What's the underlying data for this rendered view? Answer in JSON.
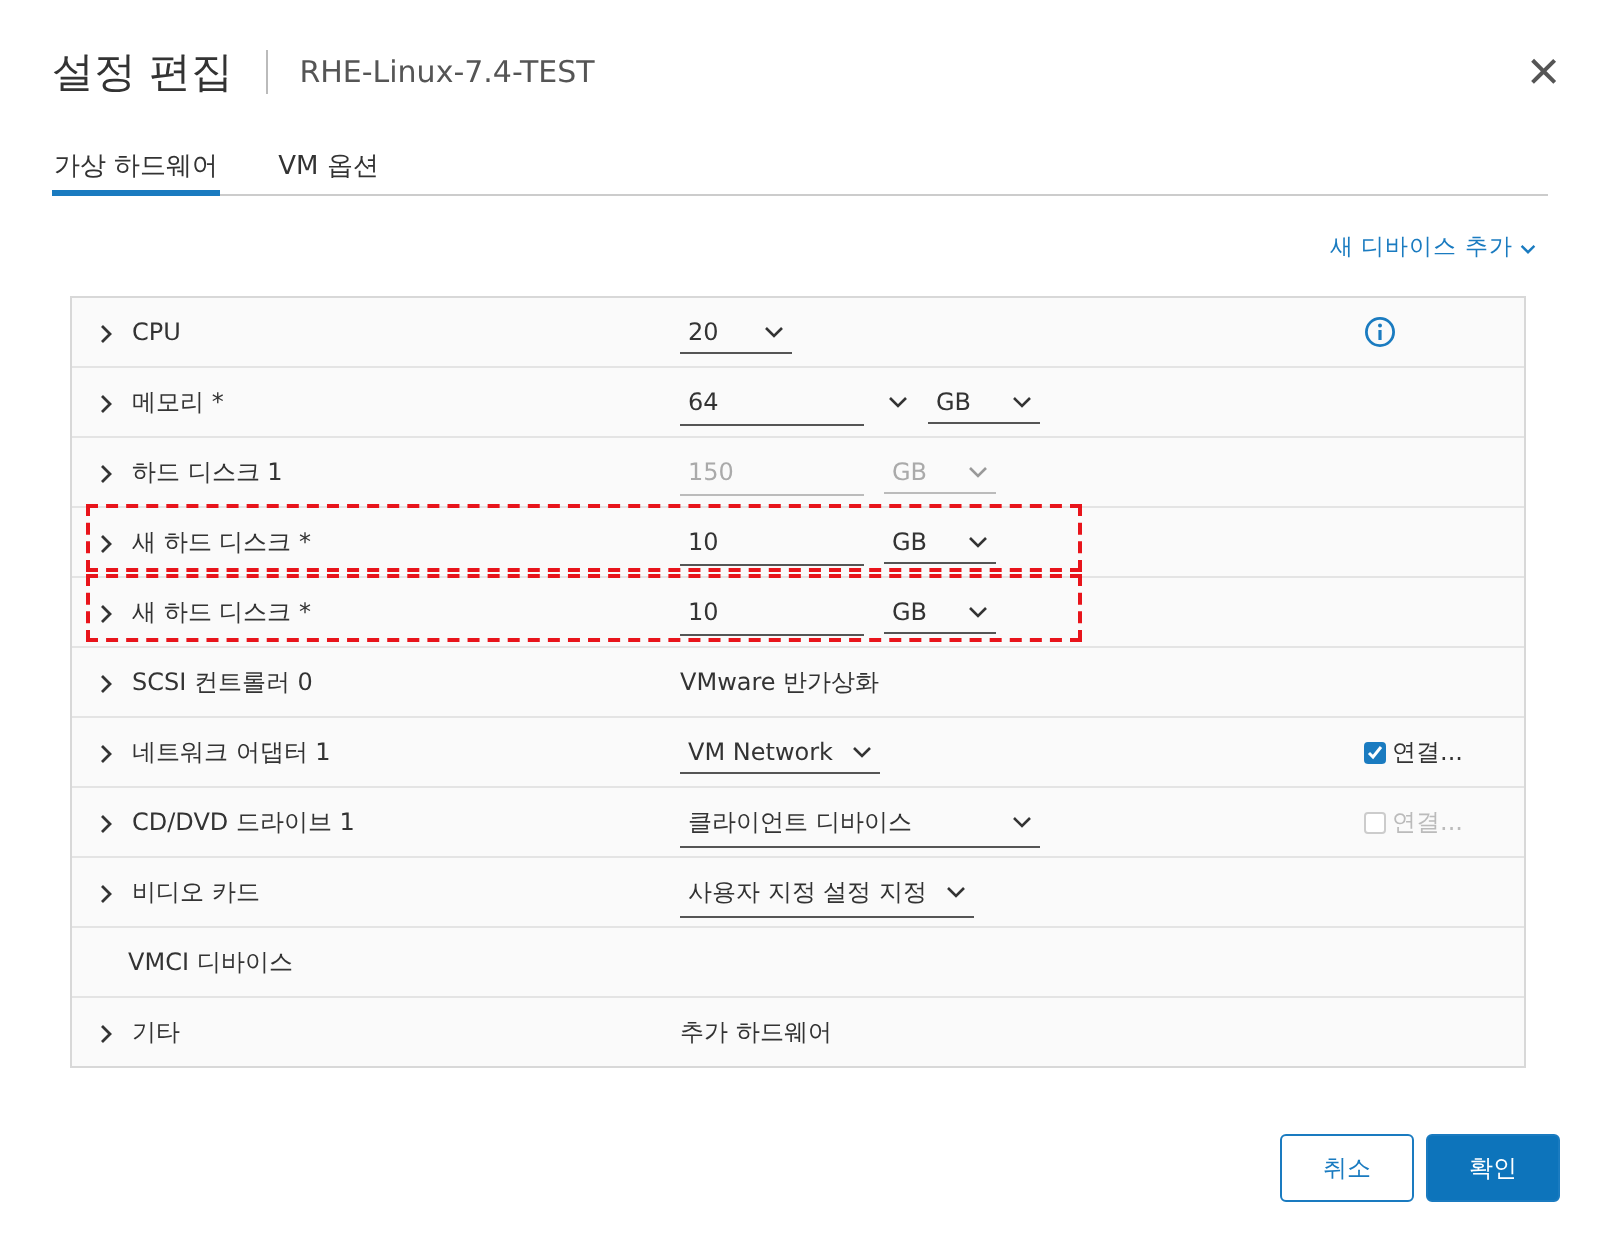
{
  "dialog": {
    "title": "설정 편집",
    "subtitle": "RHE-Linux-7.4-TEST",
    "close": "×"
  },
  "tabs": [
    {
      "label": "가상 하드웨어",
      "selected": true
    },
    {
      "label": "VM 옵션",
      "selected": false
    }
  ],
  "add_device": "새 디바이스 추가",
  "rows": [
    {
      "label": "CPU",
      "expandable": true,
      "highlighted": false,
      "info": true,
      "controls": [
        {
          "kind": "select",
          "value": "20",
          "disabled": false
        }
      ]
    },
    {
      "label": "메모리 *",
      "expandable": true,
      "highlighted": false,
      "controls": [
        {
          "kind": "combo",
          "value": "64",
          "disabled": false
        },
        {
          "kind": "select",
          "value": "GB",
          "disabled": false
        }
      ]
    },
    {
      "label": "하드 디스크 1",
      "expandable": true,
      "highlighted": false,
      "controls": [
        {
          "kind": "input",
          "value": "150",
          "disabled": true
        },
        {
          "kind": "select",
          "value": "GB",
          "disabled": true
        }
      ]
    },
    {
      "label": "새 하드 디스크 *",
      "expandable": true,
      "highlighted": true,
      "controls": [
        {
          "kind": "input",
          "value": "10",
          "disabled": false
        },
        {
          "kind": "select",
          "value": "GB",
          "disabled": false
        }
      ]
    },
    {
      "label": "새 하드 디스크 *",
      "expandable": true,
      "highlighted": true,
      "controls": [
        {
          "kind": "input",
          "value": "10",
          "disabled": false
        },
        {
          "kind": "select",
          "value": "GB",
          "disabled": false
        }
      ]
    },
    {
      "label": "SCSI 컨트롤러 0",
      "expandable": true,
      "highlighted": false,
      "controls": [
        {
          "kind": "text",
          "value": "VMware 반가상화"
        }
      ]
    },
    {
      "label": "네트워크 어댑터 1",
      "expandable": true,
      "highlighted": false,
      "controls": [
        {
          "kind": "select",
          "value": "VM Network",
          "disabled": false
        }
      ],
      "connect": {
        "label": "연결...",
        "checked": true,
        "disabled": false
      }
    },
    {
      "label": "CD/DVD 드라이브 1",
      "expandable": true,
      "highlighted": false,
      "controls": [
        {
          "kind": "wide-select",
          "value": "클라이언트 디바이스",
          "disabled": false
        }
      ],
      "connect": {
        "label": "연결...",
        "checked": false,
        "disabled": true
      }
    },
    {
      "label": "비디오 카드",
      "expandable": true,
      "highlighted": false,
      "controls": [
        {
          "kind": "select",
          "value": "사용자 지정 설정 지정",
          "disabled": false
        }
      ]
    },
    {
      "label": "VMCI 디바이스",
      "expandable": false,
      "highlighted": false,
      "controls": []
    },
    {
      "label": "기타",
      "expandable": true,
      "highlighted": false,
      "controls": [
        {
          "kind": "text",
          "value": "추가 하드웨어"
        }
      ]
    }
  ],
  "buttons": [
    {
      "label": "취소",
      "kind": "secondary"
    },
    {
      "label": "확인",
      "kind": "primary"
    }
  ]
}
